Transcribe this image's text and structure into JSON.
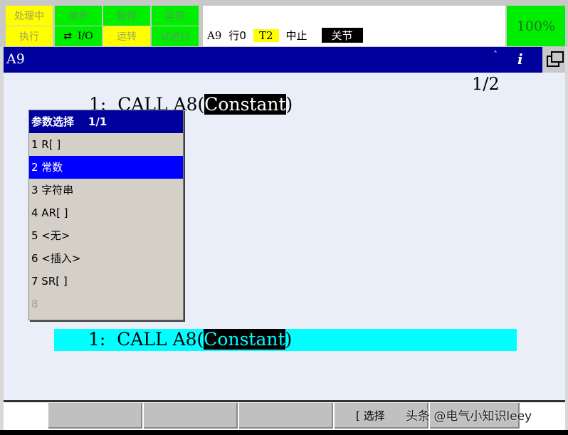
{
  "status": {
    "processing": "处理中",
    "step": "单步",
    "hold": "暂停",
    "fault": "异常",
    "execute": "执行",
    "io": "I/O",
    "running": "运转",
    "test_run": "试运行"
  },
  "info": {
    "program": "A9",
    "line": "行0",
    "mode": "T2",
    "state": "中止",
    "coord": "关节",
    "override": "100%"
  },
  "titlebar": {
    "title": "A9",
    "caret": "ˆ",
    "info_label": "i"
  },
  "editor": {
    "page": "1/2",
    "line_num": "1:",
    "line_code": "CALL A8(",
    "line_arg": "Constant",
    "line_close": ")"
  },
  "popup": {
    "title": "参数选择",
    "page": "1/1",
    "items": [
      "1 R[ ]",
      "2 常数",
      "3 字符串",
      "4 AR[ ]",
      "5 <无>",
      "6 <插入>",
      "7 SR[ ]",
      "8"
    ]
  },
  "prompt": {
    "line_num": "1:",
    "line_code": "CALL A8(",
    "line_arg": "Constant",
    "line_close": ")"
  },
  "fkeys": {
    "f4": "[ 选择"
  },
  "watermark": "头条 @电气小知识leey"
}
